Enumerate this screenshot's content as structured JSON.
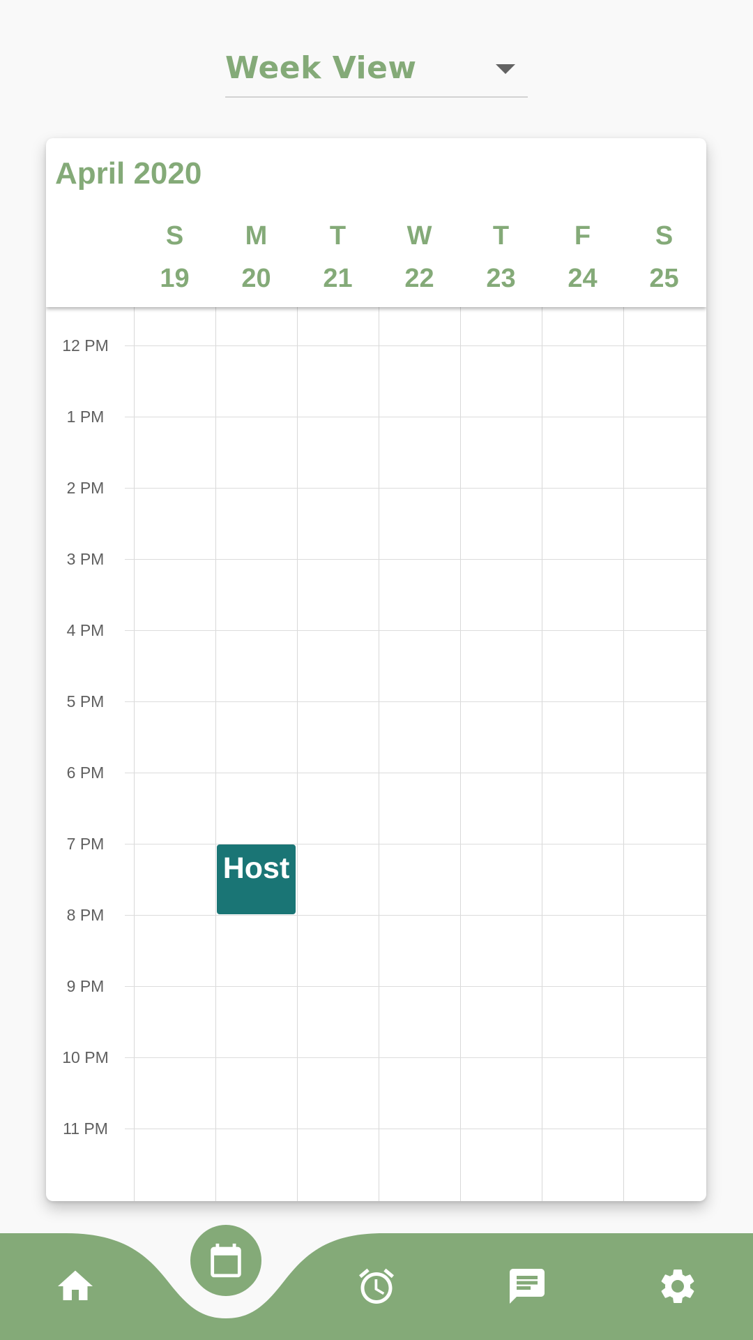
{
  "view_selector": {
    "label": "Week View"
  },
  "calendar": {
    "month_title": "April 2020",
    "days": [
      {
        "dow": "S",
        "date": "19"
      },
      {
        "dow": "M",
        "date": "20"
      },
      {
        "dow": "T",
        "date": "21"
      },
      {
        "dow": "W",
        "date": "22"
      },
      {
        "dow": "T",
        "date": "23"
      },
      {
        "dow": "F",
        "date": "24"
      },
      {
        "dow": "S",
        "date": "25"
      }
    ],
    "hours": [
      "12 PM",
      "1 PM",
      "2 PM",
      "3 PM",
      "4 PM",
      "5 PM",
      "6 PM",
      "7 PM",
      "8 PM",
      "9 PM",
      "10 PM",
      "11 PM"
    ],
    "event": {
      "title": "Host",
      "day": "20",
      "start": "7 PM",
      "end": "8 PM"
    }
  },
  "bottom_nav": {
    "items": [
      {
        "icon": "home-icon"
      },
      {
        "icon": "calendar-icon",
        "active": true
      },
      {
        "icon": "alarm-clock-icon"
      },
      {
        "icon": "chat-icon"
      },
      {
        "icon": "gear-icon"
      }
    ]
  },
  "colors": {
    "accent": "#84aa78",
    "event": "#1a7575",
    "background": "#f9f9f9"
  }
}
